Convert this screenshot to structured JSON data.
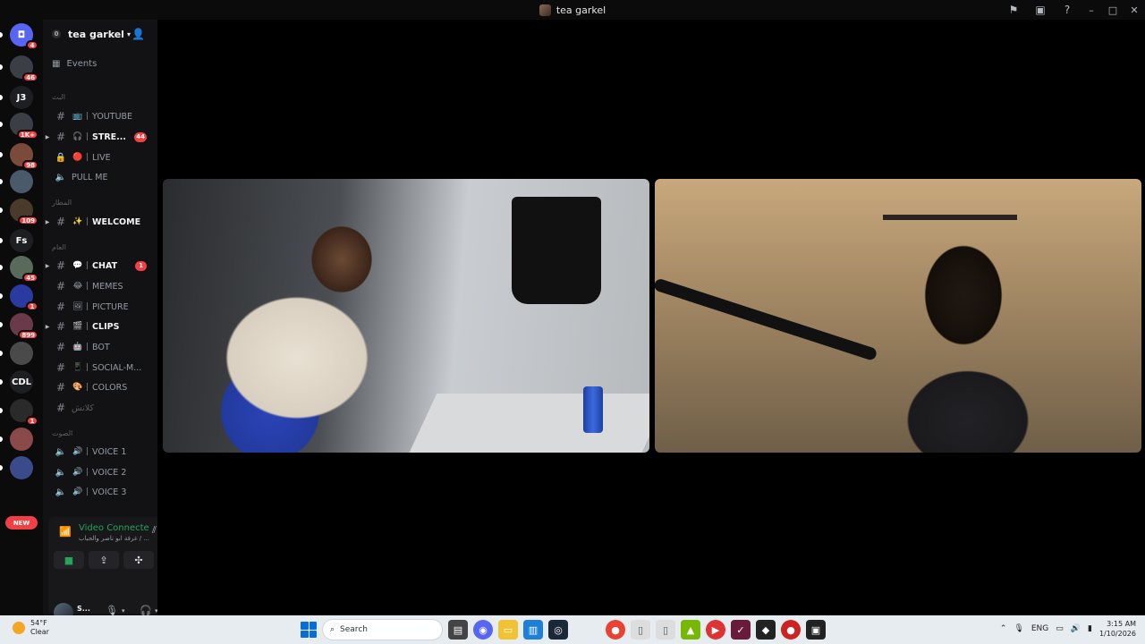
{
  "window": {
    "title": "tea garkel"
  },
  "rail": {
    "servers": [
      {
        "name": "discord-home",
        "glyph": "◘",
        "badge": "4",
        "color": "#5865f2"
      },
      {
        "name": "server-1",
        "glyph": "",
        "badge": "46",
        "color": "#3b3f45"
      },
      {
        "name": "server-j3",
        "glyph": "J3",
        "badge": "",
        "color": "#1e1f22"
      },
      {
        "name": "server-3",
        "glyph": "",
        "badge": "1K+",
        "color": "#3b3f45"
      },
      {
        "name": "server-4",
        "glyph": "",
        "badge": "98",
        "color": "#7a4a3a"
      },
      {
        "name": "server-5",
        "glyph": "",
        "badge": "",
        "color": "#4a5a6a"
      },
      {
        "name": "server-6",
        "glyph": "",
        "badge": "109",
        "color": "#4a3a2a"
      },
      {
        "name": "server-fs",
        "glyph": "Fs",
        "badge": "",
        "color": "#1e1f22"
      },
      {
        "name": "server-8",
        "glyph": "",
        "badge": "45",
        "color": "#5a6a5a"
      },
      {
        "name": "server-9",
        "glyph": "",
        "badge": "1",
        "color": "#2a3aa0"
      },
      {
        "name": "server-10",
        "glyph": "",
        "badge": "899",
        "color": "#6a3a4a"
      },
      {
        "name": "server-11",
        "glyph": "",
        "badge": "",
        "color": "#4a4a4a"
      },
      {
        "name": "server-cdl",
        "glyph": "CDL",
        "badge": "",
        "color": "#1e1f22"
      },
      {
        "name": "server-13",
        "glyph": "",
        "badge": "1",
        "color": "#2a2a2a"
      },
      {
        "name": "server-14",
        "glyph": "",
        "badge": "",
        "color": "#8a4a4a"
      },
      {
        "name": "server-15",
        "glyph": "",
        "badge": "",
        "color": "#3a4a8a"
      }
    ],
    "new_label": "NEW"
  },
  "guild": {
    "name": "tea garkel",
    "boost": "0",
    "events_label": "Events"
  },
  "categories": [
    "البث",
    "المطار",
    "العام",
    "الصوت"
  ],
  "channels": [
    {
      "label": "YOUTUBE",
      "type": "text",
      "emoji": "📺",
      "unread": false,
      "badge": "",
      "arrow": false
    },
    {
      "label": "STRE...",
      "type": "text",
      "emoji": "🎧",
      "unread": true,
      "badge": "44",
      "arrow": true
    },
    {
      "label": "LIVE",
      "type": "locked",
      "emoji": "🔴",
      "unread": false,
      "badge": "",
      "arrow": false
    },
    {
      "label": "PULL ME",
      "type": "voice",
      "emoji": "",
      "unread": false,
      "badge": "",
      "arrow": false
    },
    {
      "label": "WELCOME",
      "type": "text",
      "emoji": "✨",
      "unread": true,
      "badge": "",
      "arrow": true
    },
    {
      "label": "CHAT",
      "type": "text",
      "emoji": "💬",
      "unread": true,
      "badge": "1",
      "arrow": true
    },
    {
      "label": "MEMES",
      "type": "text",
      "emoji": "😂",
      "unread": false,
      "badge": "",
      "arrow": false
    },
    {
      "label": "PICTURE",
      "type": "text",
      "emoji": "🖼",
      "unread": false,
      "badge": "",
      "arrow": false
    },
    {
      "label": "CLIPS",
      "type": "text",
      "emoji": "🎬",
      "unread": true,
      "badge": "",
      "arrow": true
    },
    {
      "label": "BOT",
      "type": "text",
      "emoji": "🤖",
      "unread": false,
      "badge": "",
      "arrow": false
    },
    {
      "label": "SOCIAL-M...",
      "type": "text",
      "emoji": "📱",
      "unread": false,
      "badge": "",
      "arrow": false
    },
    {
      "label": "COLORS",
      "type": "text",
      "emoji": "🎨",
      "unread": false,
      "badge": "",
      "arrow": false
    },
    {
      "label": "VOICE 1",
      "type": "voice",
      "emoji": "🔊",
      "unread": false,
      "badge": "",
      "arrow": false
    },
    {
      "label": "VOICE 2",
      "type": "voice",
      "emoji": "🔊",
      "unread": false,
      "badge": "",
      "arrow": false
    },
    {
      "label": "VOICE 3",
      "type": "voice",
      "emoji": "🔊",
      "unread": false,
      "badge": "",
      "arrow": false
    }
  ],
  "extra_label": "كلاتش",
  "voice_panel": {
    "status": "Video Connecte",
    "channel": "غرفة ابو ناصر والحباب / ...",
    "status_color": "#23a55a"
  },
  "user": {
    "name": "S..."
  },
  "taskbar": {
    "weather_temp": "54°F",
    "weather_desc": "Clear",
    "search_placeholder": "Search",
    "lang": "ENG",
    "time": "3:15 AM",
    "date": "1/10/2026"
  }
}
